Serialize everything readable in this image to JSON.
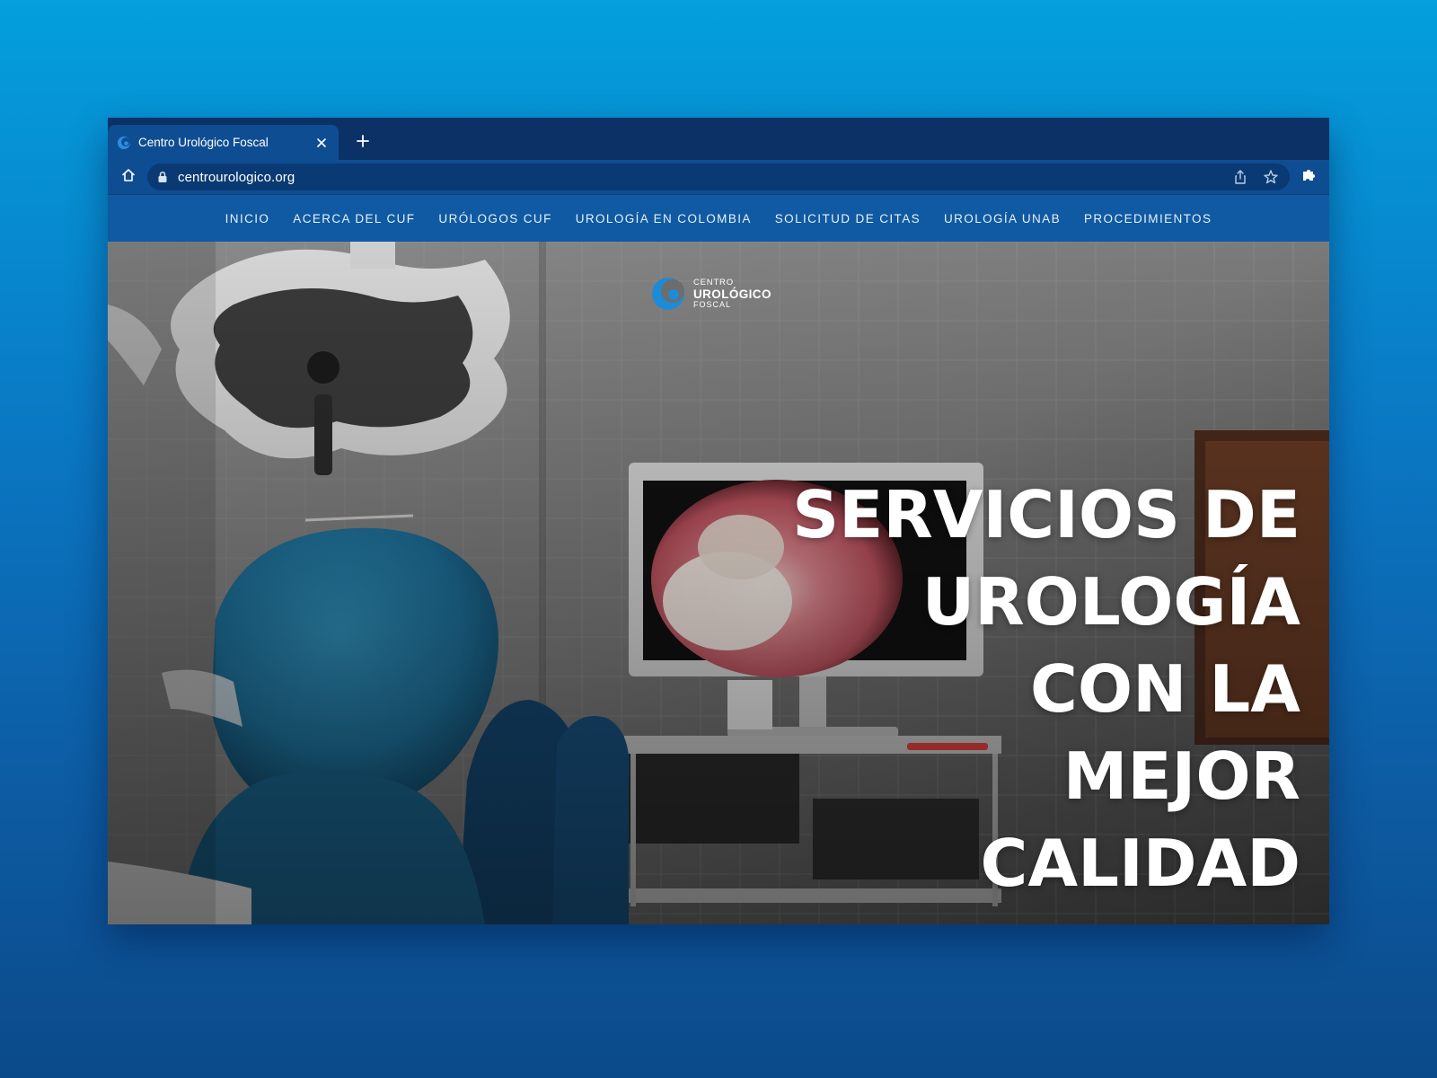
{
  "colors": {
    "background_top": "#049fdd",
    "background_bottom": "#0b4a8a",
    "tab_bar": "#0c3166",
    "toolbar": "#0f4d93",
    "site_nav": "#0f5aa2",
    "logo_accent": "#1e8bd8",
    "headline_text": "#ffffff"
  },
  "browser": {
    "tab": {
      "title": "Centro Urológico Foscal",
      "favicon": "crescent-logo-icon"
    },
    "address_bar": {
      "url": "centrourologico.org",
      "icons": [
        "home-icon",
        "lock-icon",
        "share-icon",
        "bookmark-star-icon",
        "extensions-puzzle-icon"
      ]
    }
  },
  "site": {
    "nav": [
      {
        "label": "INICIO"
      },
      {
        "label": "ACERCA DEL CUF"
      },
      {
        "label": "URÓLOGOS CUF"
      },
      {
        "label": "UROLOGÍA EN COLOMBIA"
      },
      {
        "label": "SOLICITUD DE CITAS"
      },
      {
        "label": "UROLOGÍA UNAB"
      },
      {
        "label": "PROCEDIMIENTOS"
      }
    ],
    "logo": {
      "line1": "CENTRO",
      "line2": "UROLÓGICO",
      "line3": "FOSCAL"
    },
    "hero": {
      "headline_lines": [
        "SERVICIOS DE",
        "UROLOGÍA",
        "CON LA",
        "MEJOR",
        "CALIDAD"
      ]
    }
  }
}
